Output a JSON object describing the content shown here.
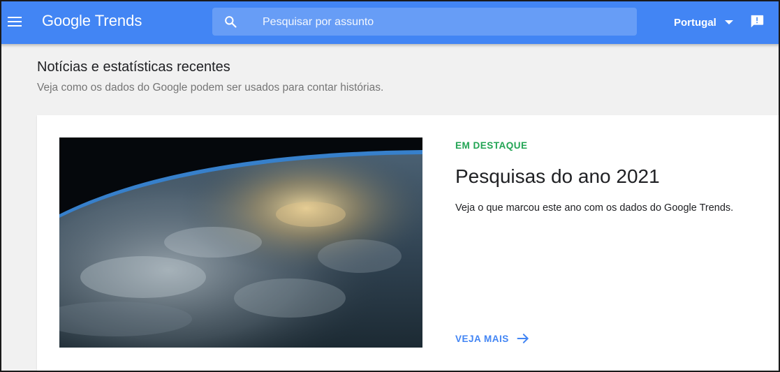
{
  "header": {
    "brand": "Google",
    "product": "Trends",
    "search_placeholder": "Pesquisar por assunto",
    "country": "Portugal"
  },
  "section": {
    "title": "Notícias e estatísticas recentes",
    "subtitle": "Veja como os dados do Google podem ser usados para contar histórias."
  },
  "featured": {
    "kicker": "EM DESTAQUE",
    "title": "Pesquisas do ano 2021",
    "description": "Veja o que marcou este ano com os dados do Google Trends.",
    "more_label": "VEJA MAIS"
  },
  "colors": {
    "header_bg": "#4285f4",
    "search_bg": "#679df6",
    "kicker": "#21a453",
    "link": "#4285f4",
    "page_bg": "#f1f1f1"
  },
  "icons": [
    "menu-icon",
    "search-icon",
    "dropdown-caret-icon",
    "feedback-icon",
    "arrow-forward-icon"
  ]
}
